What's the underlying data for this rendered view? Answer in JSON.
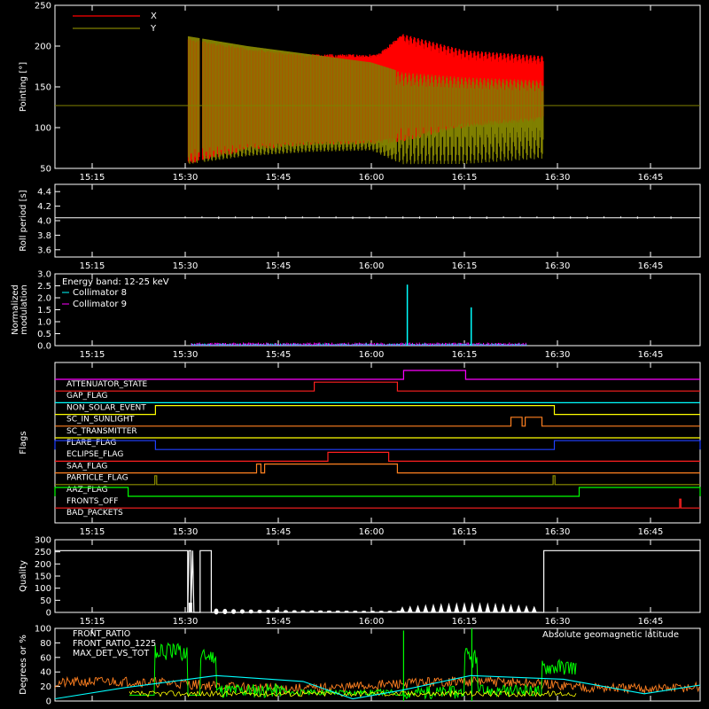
{
  "colors": {
    "x": "#ff0000",
    "y": "#808000",
    "white": "#ffffff",
    "cyan": "#00ffff",
    "magenta": "#ff00ff",
    "red": "#ff2020",
    "green": "#00ff00",
    "orange": "#ff8020",
    "yellow": "#ffff00",
    "blue": "#2040ff",
    "olive": "#909000"
  },
  "time_axis": {
    "range_minutes": [
      909,
      1013
    ],
    "ticks": [
      {
        "t": 915,
        "label": "15:15"
      },
      {
        "t": 930,
        "label": "15:30"
      },
      {
        "t": 945,
        "label": "15:45"
      },
      {
        "t": 960,
        "label": "16:00"
      },
      {
        "t": 975,
        "label": "16:15"
      },
      {
        "t": 990,
        "label": "16:30"
      },
      {
        "t": 1005,
        "label": "16:45"
      }
    ]
  },
  "chart_data": [
    {
      "type": "area",
      "ylabel": "Pointing [°]",
      "ylim": [
        50,
        250
      ],
      "yticks": [
        "50",
        "100",
        "150",
        "200",
        "250"
      ],
      "legend": [
        "X",
        "Y"
      ],
      "reference_line": 127,
      "data_start": 930.5,
      "data_end": 987.8,
      "gap": [
        932.3,
        932.8
      ],
      "series": [
        {
          "name": "X",
          "x": [
            930.5,
            940,
            950,
            961,
            965,
            975,
            987.8
          ],
          "max": [
            210,
            198,
            190,
            190,
            215,
            195,
            188
          ],
          "min": [
            55,
            72,
            78,
            80,
            82,
            100,
            108
          ]
        },
        {
          "name": "Y",
          "x": [
            930.5,
            940,
            950,
            960,
            965,
            975,
            987.8
          ],
          "max": [
            212,
            200,
            190,
            180,
            168,
            162,
            158
          ],
          "min": [
            55,
            65,
            70,
            72,
            55,
            55,
            62
          ]
        }
      ]
    },
    {
      "type": "line",
      "ylabel": "Roll period [s]",
      "ylim": [
        3.5,
        4.5
      ],
      "yticks": [
        "3.6",
        "3.8",
        "4.0",
        "4.2",
        "4.4"
      ],
      "series": [
        {
          "name": "",
          "value": 4.04
        }
      ]
    },
    {
      "type": "line",
      "ylabel": "Normalized modulation",
      "ylim": [
        0,
        3
      ],
      "yticks": [
        "0.0",
        "0.5",
        "1.0",
        "1.5",
        "2.0",
        "2.5",
        "3.0"
      ],
      "annotation": "Energy band: 12-25 keV",
      "baseline_range": [
        931,
        985
      ],
      "spikes": [
        {
          "t": 965.8,
          "value": 2.55
        },
        {
          "t": 976.1,
          "value": 1.6
        }
      ],
      "series": [
        {
          "name": "Collimator 8",
          "color": "cyan"
        },
        {
          "name": "Collimator 9",
          "color": "magenta"
        }
      ]
    },
    {
      "type": "line",
      "ylabel": "Flags",
      "flags": [
        {
          "name": "ATTENUATOR_STATE",
          "color": "#ff00ff",
          "high": [
            [
              965.2,
              975.2
            ]
          ]
        },
        {
          "name": "GAP_FLAG",
          "color": "#ff2020",
          "high": [
            [
              950.8,
              964.2
            ]
          ]
        },
        {
          "name": "NON_SOLAR_EVENT",
          "color": "#00ffff",
          "high": []
        },
        {
          "name": "SC_IN_SUNLIGHT",
          "color": "#ffff00",
          "high": [
            [
              925.2,
              989.5
            ]
          ]
        },
        {
          "name": "SC_TRANSMITTER",
          "color": "#ff8020",
          "high": [
            [
              982.5,
              984.3
            ],
            [
              984.8,
              987.5
            ]
          ]
        },
        {
          "name": "FLARE_FLAG",
          "color": "#ffff00",
          "high": []
        },
        {
          "name": "ECLIPSE_FLAG",
          "color": "#2040ff",
          "high": [
            [
              909,
              925.2
            ],
            [
              989.5,
              1013
            ]
          ]
        },
        {
          "name": "SAA_FLAG",
          "color": "#ff2020",
          "high": [
            [
              953,
              962.8
            ]
          ]
        },
        {
          "name": "PARTICLE_FLAG",
          "color": "#ff8020",
          "high": [
            [
              941.5,
              942.2
            ],
            [
              942.8,
              964.2
            ]
          ]
        },
        {
          "name": "AAZ_FLAG",
          "color": "#909000",
          "high": [
            [
              925.1,
              925.4
            ],
            [
              989.3,
              989.6
            ]
          ]
        },
        {
          "name": "FRONTS_OFF",
          "color": "#00ff00",
          "high": [
            [
              909,
              920.8
            ],
            [
              993.5,
              1013
            ]
          ]
        },
        {
          "name": "BAD_PACKETS",
          "color": "#ff2020",
          "high": [
            [
              1009.7,
              1009.9
            ]
          ]
        }
      ]
    },
    {
      "type": "area",
      "ylabel": "Quality",
      "ylim": [
        0,
        300
      ],
      "yticks": [
        "0",
        "50",
        "100",
        "150",
        "200",
        "250",
        "300"
      ],
      "high_blocks": [
        [
          909,
          930.4
        ],
        [
          932.4,
          934.2
        ],
        [
          987.8,
          1013
        ]
      ],
      "bursts_start": 965,
      "bursts_end": 987
    },
    {
      "type": "line",
      "ylabel": "Degrees or %",
      "ylim": [
        0,
        100
      ],
      "yticks": [
        "0",
        "20",
        "40",
        "60",
        "80",
        "100"
      ],
      "legend_right": "Absolute geomagnetic latitude",
      "series": [
        {
          "name": "FRONT_RATIO",
          "color": "yellow"
        },
        {
          "name": "FRONT_RATIO_1225",
          "color": "green"
        },
        {
          "name": "MAX_DET_VS_TOT",
          "color": "orange"
        },
        {
          "name": "Absolute geomagnetic latitude",
          "color": "cyan",
          "x": [
            909,
            920,
            935,
            949,
            957,
            965,
            976,
            991,
            1004,
            1013
          ],
          "y": [
            3,
            18,
            35,
            27,
            3,
            15,
            35,
            30,
            10,
            22
          ]
        }
      ]
    }
  ]
}
